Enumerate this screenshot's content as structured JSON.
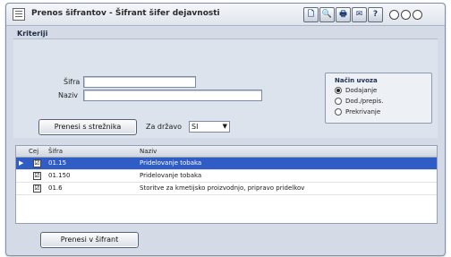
{
  "window": {
    "title": "Prenos šifrantov - Šifrant šifer dejavnosti",
    "toolbar_glyphs": [
      "🗋",
      "🔍",
      "🖶",
      "✉",
      "?"
    ]
  },
  "criteria": {
    "section_label": "Kriteriji",
    "sifra_label": "Šifra",
    "naziv_label": "Naziv",
    "sifra_value": "",
    "naziv_value": "",
    "transfer_from_server_label": "Prenesi s strežnika",
    "za_drzavo_label": "Za državo",
    "country_value": "SI"
  },
  "merge_mode": {
    "title": "Način uvoza",
    "options": [
      "Dodajanje",
      "Dod./prepis.",
      "Prekrivanje"
    ],
    "selected_index": 0
  },
  "table": {
    "headers": {
      "check": "Cej",
      "code": "Šifra",
      "name": "Naziv"
    },
    "rows": [
      {
        "indicator": "▶",
        "check": "☑",
        "code": "01.15",
        "name": "Pridelovanje tobaka",
        "selected": true
      },
      {
        "indicator": "",
        "check": "☑",
        "code": "01.150",
        "name": "Pridelovanje tobaka",
        "selected": false
      },
      {
        "indicator": "",
        "check": "☑",
        "code": "01.6",
        "name": "Storitve za kmetijsko proizvodnjo, pripravo pridelkov",
        "selected": false
      }
    ]
  },
  "footer": {
    "transfer_to_registry_label": "Prenesi v šifrant"
  }
}
